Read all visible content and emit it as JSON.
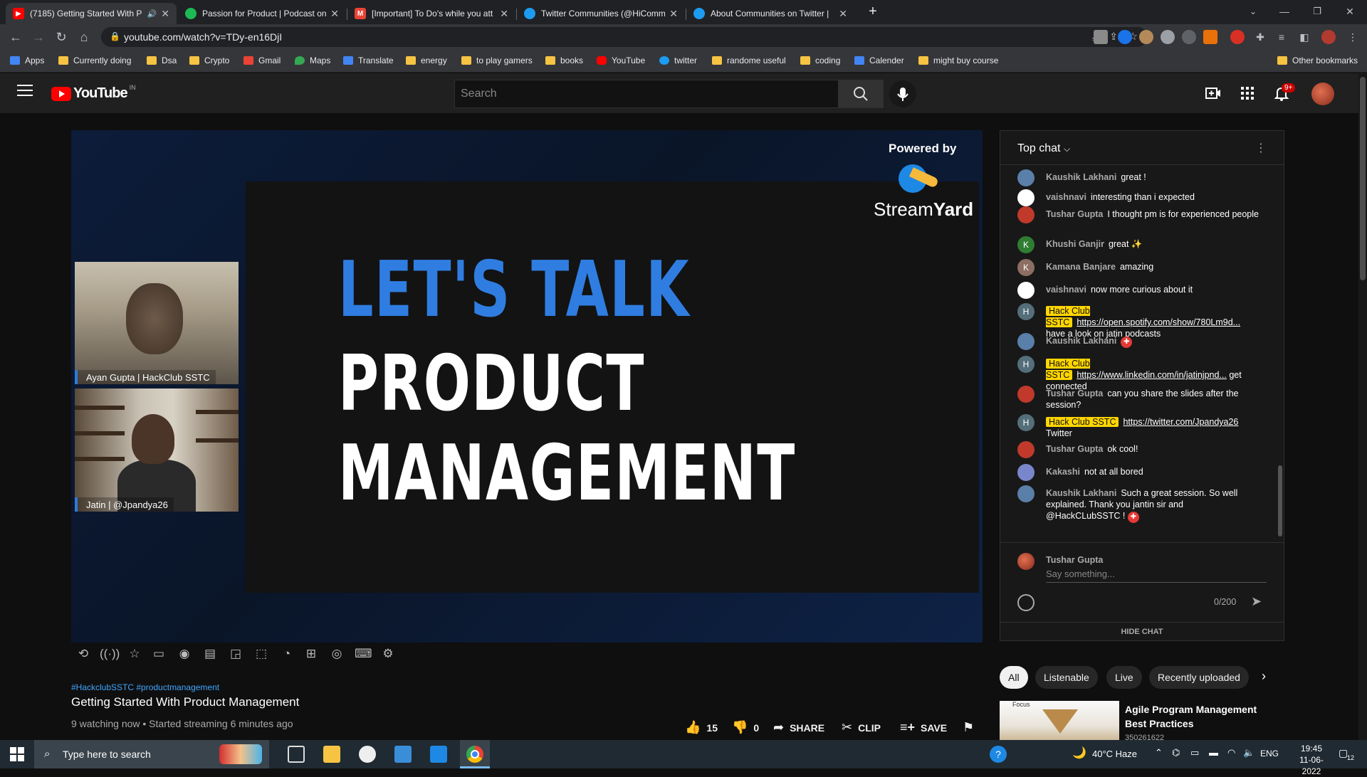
{
  "browser": {
    "tabs": [
      {
        "title": "(7185) Getting Started With P",
        "icon_color": "#ff0000",
        "active": true
      },
      {
        "title": "Passion for Product | Podcast on",
        "icon_color": "#1db954",
        "active": false
      },
      {
        "title": "[Important] To Do's while you att",
        "icon_color": "#ea4335",
        "active": false
      },
      {
        "title": "Twitter Communities (@HiComm",
        "icon_color": "#1d9bf0",
        "active": false
      },
      {
        "title": "About Communities on Twitter |",
        "icon_color": "#1d9bf0",
        "active": false
      }
    ],
    "new_tab": "+",
    "url": "youtube.com/watch?v=TDy-en16DjI",
    "bookmarks": [
      {
        "label": "Apps",
        "color": "#4285f4"
      },
      {
        "label": "Currently doing",
        "color": "#f6c343"
      },
      {
        "label": "Dsa",
        "color": "#f6c343"
      },
      {
        "label": "Crypto",
        "color": "#f6c343"
      },
      {
        "label": "Gmail",
        "color": "#ea4335"
      },
      {
        "label": "Maps",
        "color": "#34a853"
      },
      {
        "label": "Translate",
        "color": "#4285f4"
      },
      {
        "label": "energy",
        "color": "#f6c343"
      },
      {
        "label": "to play gamers",
        "color": "#f6c343"
      },
      {
        "label": "books",
        "color": "#f6c343"
      },
      {
        "label": "YouTube",
        "color": "#ff0000"
      },
      {
        "label": "twitter",
        "color": "#1d9bf0"
      },
      {
        "label": "randome useful",
        "color": "#f6c343"
      },
      {
        "label": "coding",
        "color": "#f6c343"
      },
      {
        "label": "Calender",
        "color": "#4285f4"
      },
      {
        "label": "might buy course",
        "color": "#f6c343"
      }
    ],
    "other_bookmarks": "Other bookmarks"
  },
  "youtube": {
    "logo_text": "YouTube",
    "country": "IN",
    "search_placeholder": "Search",
    "notifications_badge": "9+"
  },
  "video": {
    "slide_line1": "LET'S TALK",
    "slide_line2": "PRODUCT",
    "slide_line3": "MANAGEMENT",
    "powered_by": "Powered by",
    "streamyard_stream": "Stream",
    "streamyard_yard": "Yard",
    "cam1_label": "Ayan Gupta | HackClub SSTC",
    "cam2_label": "Jatin  |  @Jpandya26",
    "tags": "#HackclubSSTC #productmanagement",
    "title": "Getting Started With Product Management",
    "meta": "9 watching now • Started streaming 6 minutes ago",
    "likes": "15",
    "dislikes": "0",
    "share": "SHARE",
    "clip": "CLIP",
    "save": "SAVE"
  },
  "chat": {
    "header": "Top chat",
    "messages": [
      {
        "author": "Kaushik Lakhani",
        "text": "great !",
        "avatar_color": "#5a7fa8",
        "avatar_letter": ""
      },
      {
        "author": "vaishnavi",
        "text": "interesting than i expected",
        "avatar_color": "#ffffff",
        "avatar_letter": ""
      },
      {
        "author": "Tushar Gupta",
        "text": "I thought pm is for experienced people",
        "avatar_color": "#c0392b",
        "avatar_letter": ""
      },
      {
        "author": "Khushi Ganjir",
        "text": "great ✨",
        "avatar_color": "#2e7d32",
        "avatar_letter": "K"
      },
      {
        "author": "Kamana Banjare",
        "text": "amazing",
        "avatar_color": "#8d6e63",
        "avatar_letter": "K"
      },
      {
        "author": "vaishnavi",
        "text": "now more curious about it",
        "avatar_color": "#ffffff",
        "avatar_letter": ""
      },
      {
        "author": "Hack Club SSTC",
        "owner": true,
        "link": "https://open.spotify.com/show/780Lm9d...",
        "text": " have a look on jatin podcasts",
        "avatar_color": "#546e7a",
        "avatar_letter": "H"
      },
      {
        "author": "Kaushik Lakhani",
        "text": "✚",
        "avatar_color": "#5a7fa8",
        "avatar_letter": ""
      },
      {
        "author": "Hack Club SSTC",
        "owner": true,
        "link": "https://www.linkedin.com/in/jatinjpnd...",
        "text": " get connected",
        "avatar_color": "#546e7a",
        "avatar_letter": "H"
      },
      {
        "author": "Tushar Gupta",
        "text": "can you share the slides after the session?",
        "avatar_color": "#c0392b",
        "avatar_letter": ""
      },
      {
        "author": "Hack Club SSTC",
        "owner": true,
        "link": "https://twitter.com/Jpandya26",
        "text": " Twitter",
        "avatar_color": "#546e7a",
        "avatar_letter": "H"
      },
      {
        "author": "Tushar Gupta",
        "text": "ok cool!",
        "avatar_color": "#c0392b",
        "avatar_letter": ""
      },
      {
        "author": "Kakashi",
        "text": "not at all bored",
        "avatar_color": "#7986cb",
        "avatar_letter": ""
      },
      {
        "author": "Kaushik Lakhani",
        "text": "Such a great session. So well explained. Thank you jantin sir and @HackCLubSSTC ! ✚",
        "avatar_color": "#5a7fa8",
        "avatar_letter": ""
      }
    ],
    "current_user": "Tushar Gupta",
    "input_placeholder": "Say something...",
    "char_count": "0/200",
    "hide_chat": "HIDE CHAT"
  },
  "chips": [
    "All",
    "Listenable",
    "Live",
    "Recently uploaded"
  ],
  "recommendation": {
    "title": "Agile Program Management Best Practices",
    "meta": "350261622",
    "thumb_text": "Focus"
  },
  "taskbar": {
    "search_placeholder": "Type here to search",
    "weather": "40°C  Haze",
    "lang": "ENG",
    "time": "19:45",
    "date": "11-06-2022",
    "notif_count": "12"
  }
}
